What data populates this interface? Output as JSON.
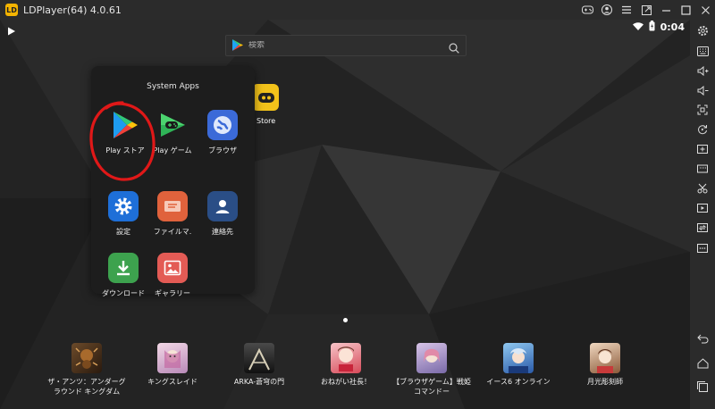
{
  "window": {
    "title": "LDPlayer(64) 4.0.61",
    "logo_text": "LD"
  },
  "titlebar_icons": [
    "gamepad-icon",
    "user-icon",
    "menu-icon",
    "external-window-icon",
    "minimize-icon",
    "maximize-icon",
    "close-icon"
  ],
  "status_bar": {
    "time": "0:04",
    "icons": [
      "play-store-notification-icon",
      "wifi-icon",
      "battery-icon"
    ]
  },
  "search": {
    "placeholder": "検索"
  },
  "desktop": {
    "partial_app_label": "Store"
  },
  "folder": {
    "title": "System Apps",
    "apps": [
      {
        "label": "Play ストア",
        "icon": "play-store-icon"
      },
      {
        "label": "Play ゲーム",
        "icon": "play-games-icon"
      },
      {
        "label": "ブラウザ",
        "icon": "browser-icon"
      },
      {
        "label": "設定",
        "icon": "settings-icon"
      },
      {
        "label": "ファイルマ.",
        "icon": "file-manager-icon"
      },
      {
        "label": "連絡先",
        "icon": "contacts-icon"
      },
      {
        "label": "ダウンロード",
        "icon": "download-icon"
      },
      {
        "label": "ギャラリー",
        "icon": "gallery-icon"
      }
    ]
  },
  "dock": {
    "games": [
      {
        "line1": "ザ・アンツ：アンダーグ",
        "line2": "ラウンド キングダム"
      },
      {
        "line1": "キングスレイド",
        "line2": ""
      },
      {
        "line1": "ARKA-蒼穹の門",
        "line2": ""
      },
      {
        "line1": "おねがい社長！",
        "line2": ""
      },
      {
        "line1": "【ブラウザゲーム】戦姫",
        "line2": "コマンドー"
      },
      {
        "line1": "イース6 オンライン",
        "line2": ""
      },
      {
        "line1": "月光彫刻師",
        "line2": ""
      }
    ]
  },
  "sidebar_tools": [
    "settings-gear-icon",
    "keyboard-icon",
    "volume-up-icon",
    "volume-down-icon",
    "fullscreen-icon",
    "rotate-icon",
    "add-apk-icon",
    "screenshot-icon",
    "scissors-icon",
    "record-icon",
    "sync-icon",
    "more-icon",
    "back-icon",
    "home-icon",
    "recent-apps-icon"
  ]
}
